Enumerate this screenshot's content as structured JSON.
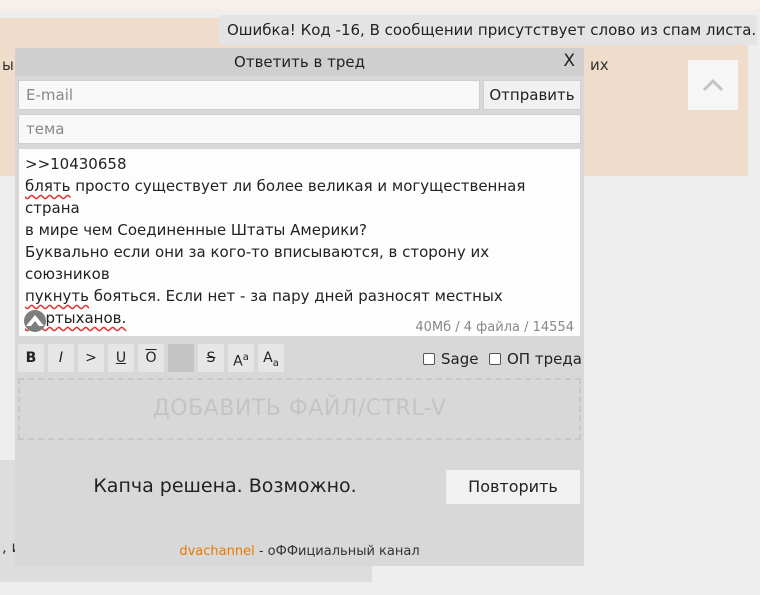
{
  "error": {
    "text": "Ошибка! Код -16, В сообщении присутствует слово из спам листа."
  },
  "background": {
    "post_left": "ы",
    "post_right": "их",
    "box2_left": ", и"
  },
  "icons": {
    "scroll_up": "chevron-up-icon",
    "close": "close-icon",
    "logo": "app-logo-icon"
  },
  "form": {
    "title": "Ответить в тред",
    "close_label": "X",
    "email_placeholder": "E-mail",
    "send_label": "Отправить",
    "subject_placeholder": "тема",
    "comment_lines": [
      ">>10430658",
      "блять просто существует ли более великая и могущественная страна",
      "в мире чем Соединенные Штаты Америки?",
      "Буквально если они за кого-то вписываются, в сторону их союзников",
      "пукнуть бояться. Если нет - за пару дней разносят местных",
      "мартыханов."
    ],
    "file_limits": "40Мб / 4 файла / 14554",
    "toolbar": {
      "bold": "B",
      "italic": "I",
      "quote": ">",
      "underline": "U",
      "overline": "O",
      "spoiler": " ",
      "strike": "S",
      "sup_big": "A",
      "sup_small": "a",
      "sub_big": "A",
      "sub_small": "a"
    },
    "sage_label": "Sage",
    "op_label": "ОП треда",
    "dropzone_label": "ДОБАВИТЬ ФАЙЛ/CTRL-V",
    "captcha_text": "Капча решена. Возможно.",
    "retry_label": "Повторить",
    "footer_link": "dvachannel",
    "footer_text": " - оФФициальный канал"
  },
  "colors": {
    "accent": "#e67a00",
    "post_bg": "#f0dccb"
  }
}
